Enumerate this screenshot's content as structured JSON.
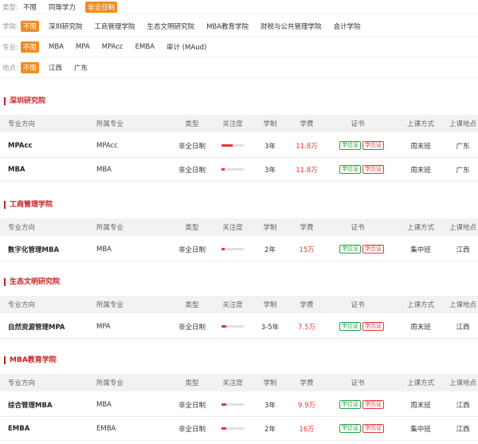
{
  "filters": {
    "type": {
      "label": "类型:",
      "options": [
        "不限",
        "同等学力",
        "非全日制"
      ],
      "active": 2
    },
    "school": {
      "label": "学院:",
      "options": [
        "不限",
        "深圳研究院",
        "工商管理学院",
        "生态文明研究院",
        "MBA教育学院",
        "财税与公共管理学院",
        "会计学院"
      ],
      "active": 0
    },
    "major": {
      "label": "专业:",
      "options": [
        "不限",
        "MBA",
        "MPA",
        "MPAcc",
        "EMBA",
        "审计 (MAud)"
      ],
      "active": 0
    },
    "location": {
      "label": "地点:",
      "options": [
        "不限",
        "江西",
        "广东"
      ],
      "active": 0
    }
  },
  "table_headers": {
    "direction": "专业方向",
    "major": "所属专业",
    "type": "类型",
    "attention": "关注度",
    "duration": "学制",
    "fee": "学费",
    "cert": "证书",
    "mode": "上课方式",
    "location": "上课地点"
  },
  "cert_labels": {
    "degree": "学位证",
    "diploma": "学历证"
  },
  "colors": {
    "accent": "#f28b1e",
    "section": "#c81e1e",
    "fee": "#e4393c",
    "cert_green": "#25a24a"
  },
  "sections": [
    {
      "title": "深圳研究院",
      "rows": [
        {
          "direction": "MPAcc",
          "major": "MPAcc",
          "type": "非全日制",
          "attention": 0.5,
          "duration": "3年",
          "fee": "11.8万",
          "mode": "周末班",
          "location": "广东"
        },
        {
          "direction": "MBA",
          "major": "MBA",
          "type": "非全日制",
          "attention": 0.15,
          "duration": "3年",
          "fee": "11.8万",
          "mode": "周末班",
          "location": "广东"
        }
      ]
    },
    {
      "title": "工商管理学院",
      "rows": [
        {
          "direction": "数字化管理MBA",
          "major": "MBA",
          "type": "非全日制",
          "attention": 0.15,
          "duration": "2年",
          "fee": "15万",
          "mode": "集中班",
          "location": "江西"
        }
      ]
    },
    {
      "title": "生态文明研究院",
      "rows": [
        {
          "direction": "自然资源管理MPA",
          "major": "MPA",
          "type": "非全日制",
          "attention": 0.2,
          "duration": "3-5年",
          "fee": "7.5万",
          "mode": "周末班",
          "location": "江西"
        }
      ]
    },
    {
      "title": "MBA教育学院",
      "rows": [
        {
          "direction": "综合管理MBA",
          "major": "MBA",
          "type": "非全日制",
          "attention": 0.2,
          "duration": "3年",
          "fee": "9.9万",
          "mode": "周末班",
          "location": "江西"
        },
        {
          "direction": "EMBA",
          "major": "EMBA",
          "type": "非全日制",
          "attention": 0.2,
          "duration": "2年",
          "fee": "16万",
          "mode": "集中班",
          "location": "江西"
        }
      ]
    }
  ]
}
